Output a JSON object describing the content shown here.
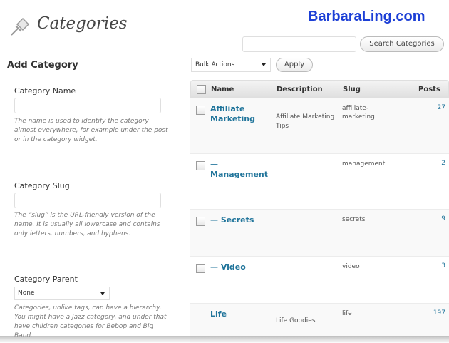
{
  "header": {
    "title": "Categories",
    "brand": "BarbaraLing.com",
    "search_button": "Search Categories"
  },
  "add_category": {
    "heading": "Add Category",
    "name_label": "Category Name",
    "name_help": "The name is used to identify the category almost everywhere, for example under the post or in the category widget.",
    "slug_label": "Category Slug",
    "slug_help": "The “slug” is the URL-friendly version of the name. It is usually all lowercase and contains only letters, numbers, and hyphens.",
    "parent_label": "Category Parent",
    "parent_value": "None",
    "parent_help": "Categories, unlike tags, can have a hierarchy. You might have a Jazz category, and under that have children categories for Bebop and Big Band."
  },
  "table_controls": {
    "bulk_actions": "Bulk Actions",
    "apply": "Apply"
  },
  "table": {
    "columns": {
      "name": "Name",
      "description": "Description",
      "slug": "Slug",
      "posts": "Posts"
    },
    "rows": [
      {
        "name": "Affiliate Marketing",
        "description": "Affiliate Marketing Tips",
        "slug": "affiliate-marketing",
        "posts": "27"
      },
      {
        "name": "— Management",
        "description": "",
        "slug": "management",
        "posts": "2"
      },
      {
        "name": "— Secrets",
        "description": "",
        "slug": "secrets",
        "posts": "9"
      },
      {
        "name": "— Video",
        "description": "",
        "slug": "video",
        "posts": "3"
      },
      {
        "name": "Life",
        "description": "Life Goodies",
        "slug": "life",
        "posts": "197"
      }
    ]
  },
  "colors": {
    "link": "#21759b",
    "brand": "#1c3fd6"
  }
}
